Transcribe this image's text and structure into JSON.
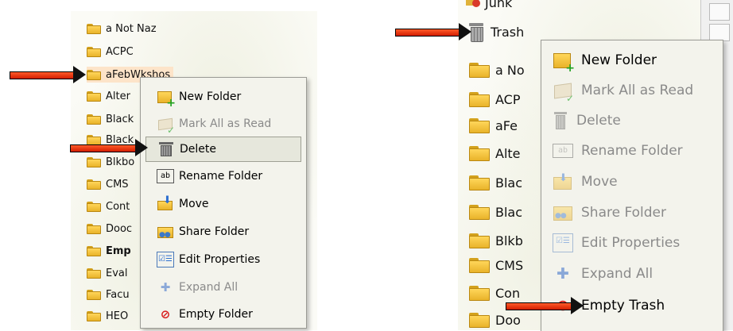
{
  "left": {
    "folders": [
      {
        "label": "a Not Naz",
        "bold": false,
        "selected": false
      },
      {
        "label": "ACPC",
        "bold": false,
        "selected": false
      },
      {
        "label": "aFebWkshos",
        "bold": false,
        "selected": true
      },
      {
        "label": "Alter",
        "bold": false,
        "selected": false
      },
      {
        "label": "Black",
        "bold": false,
        "selected": false
      },
      {
        "label": "Black",
        "bold": false,
        "selected": false
      },
      {
        "label": "Blkbo",
        "bold": false,
        "selected": false
      },
      {
        "label": "CMS",
        "bold": false,
        "selected": false
      },
      {
        "label": "Cont",
        "bold": false,
        "selected": false
      },
      {
        "label": "Dooc",
        "bold": false,
        "selected": false
      },
      {
        "label": "Emp",
        "bold": true,
        "selected": false
      },
      {
        "label": "Eval",
        "bold": false,
        "selected": false
      },
      {
        "label": "Facu",
        "bold": false,
        "selected": false
      },
      {
        "label": "HEO",
        "bold": false,
        "selected": false
      }
    ],
    "menu": [
      {
        "label": "New Folder",
        "icon": "new-folder-icon",
        "disabled": false,
        "hover": false
      },
      {
        "label": "Mark All as Read",
        "icon": "mark-read-icon",
        "disabled": true,
        "hover": false
      },
      {
        "label": "Delete",
        "icon": "trash-icon",
        "disabled": false,
        "hover": true
      },
      {
        "label": "Rename Folder",
        "icon": "rename-icon",
        "disabled": false,
        "hover": false
      },
      {
        "label": "Move",
        "icon": "move-icon",
        "disabled": false,
        "hover": false
      },
      {
        "label": "Share Folder",
        "icon": "share-folder-icon",
        "disabled": false,
        "hover": false
      },
      {
        "label": "Edit Properties",
        "icon": "edit-properties-icon",
        "disabled": false,
        "hover": false
      },
      {
        "label": "Expand All",
        "icon": "expand-icon",
        "disabled": true,
        "hover": false
      },
      {
        "label": "Empty Folder",
        "icon": "empty-folder-icon",
        "disabled": false,
        "hover": false
      }
    ],
    "rename_glyph": "ab"
  },
  "right": {
    "junk_label": "Junk",
    "trash_label": "Trash",
    "folders": [
      "a No",
      "ACP",
      "aFe",
      "Alte",
      "Blac",
      "Blac",
      "Blkb",
      "CMS",
      "Con",
      "Doo"
    ],
    "menu": [
      {
        "label": "New Folder",
        "icon": "new-folder-icon",
        "disabled": false
      },
      {
        "label": "Mark All as Read",
        "icon": "mark-read-icon",
        "disabled": true
      },
      {
        "label": "Delete",
        "icon": "trash-icon",
        "disabled": true
      },
      {
        "label": "Rename Folder",
        "icon": "rename-icon",
        "disabled": true
      },
      {
        "label": "Move",
        "icon": "move-icon",
        "disabled": true
      },
      {
        "label": "Share Folder",
        "icon": "share-folder-icon",
        "disabled": true
      },
      {
        "label": "Edit Properties",
        "icon": "edit-properties-icon",
        "disabled": true
      },
      {
        "label": "Expand All",
        "icon": "expand-icon",
        "disabled": true
      },
      {
        "label": "Empty Trash",
        "icon": "empty-trash-icon",
        "disabled": false
      }
    ],
    "rename_glyph": "ab"
  },
  "colors": {
    "accent_arrow": "#e8300b",
    "selection": "#fde4c9",
    "menu_bg": "#f3f3ec"
  }
}
